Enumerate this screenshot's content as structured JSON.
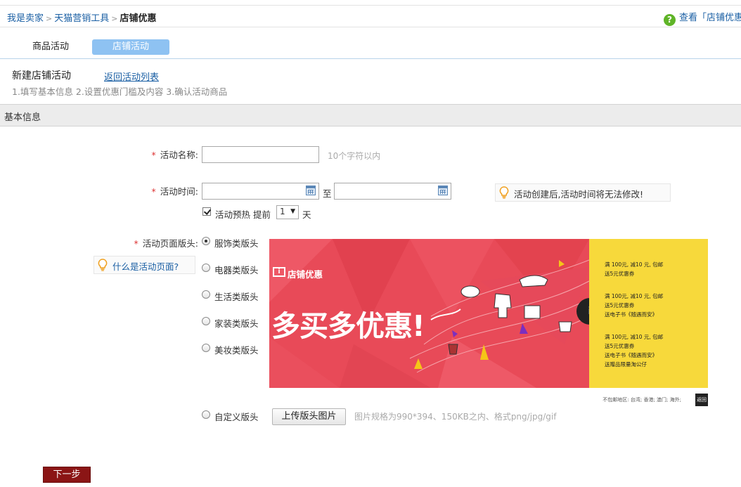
{
  "breadcrumb": {
    "items": [
      "我是卖家",
      "天猫营销工具"
    ],
    "current": "店铺优惠",
    "separator": ">"
  },
  "help_link": "查看「店铺优惠",
  "tabs": [
    {
      "label": "商品活动",
      "active": false
    },
    {
      "label": "店铺活动",
      "active": true
    }
  ],
  "header": {
    "title": "新建店铺活动",
    "back_link": "返回活动列表",
    "steps": "1.填写基本信息 2.设置优惠门槛及内容 3.确认活动商品"
  },
  "section_title": "基本信息",
  "form": {
    "required_mark": "*",
    "name": {
      "label": "活动名称:",
      "value": "",
      "hint": "10个字符以内"
    },
    "time": {
      "label": "活动时间:",
      "start": "",
      "to": "至",
      "end": "",
      "tip": "活动创建后,活动时间将无法修改!"
    },
    "preheat": {
      "checked": true,
      "label": "活动预热",
      "prefix": "提前",
      "days": "1",
      "suffix": "天"
    },
    "page_header": {
      "label": "活动页面版头:",
      "help": "什么是活动页面?",
      "options": [
        {
          "label": "服饰类版头",
          "selected": true
        },
        {
          "label": "电器类版头",
          "selected": false
        },
        {
          "label": "生活类版头",
          "selected": false
        },
        {
          "label": "家装类版头",
          "selected": false
        },
        {
          "label": "美妆类版头",
          "selected": false
        }
      ],
      "custom": {
        "label": "自定义版头",
        "selected": false,
        "upload_button": "上传版头图片",
        "spec": "图片规格为990*394、150KB之内、格式png/jpg/gif"
      }
    }
  },
  "banner": {
    "logo_text": "店铺优惠",
    "headline": "多买多优惠!",
    "offers": [
      {
        "line1": "满 100元,  减10 元, 包邮",
        "line2": "送5元优惠券"
      },
      {
        "line1": "满 100元,  减10 元, 包邮",
        "line2": "送5元优惠券",
        "line3": "送电子书《随遇而安》"
      },
      {
        "line1": "满 100元,  减10 元, 包邮",
        "line2": "送5元优惠券",
        "line3": "送电子书《随遇而安》",
        "line4": "送赠品限量淘公仔"
      }
    ],
    "footer_note": "不包邮地区: 台湾; 香港; 澳门; 海外;",
    "footer_button": "返回"
  },
  "next_button": "下一步",
  "colors": {
    "link": "#1a5fa4",
    "tab_active": "#8ec2f2",
    "banner_red": "#e84a58",
    "banner_yellow": "#f7d93b",
    "next_button": "#8b1515",
    "help_icon": "#5fb427"
  },
  "icons": [
    "question-circle-icon",
    "calendar-icon",
    "lightbulb-icon",
    "chevron-down-icon"
  ]
}
